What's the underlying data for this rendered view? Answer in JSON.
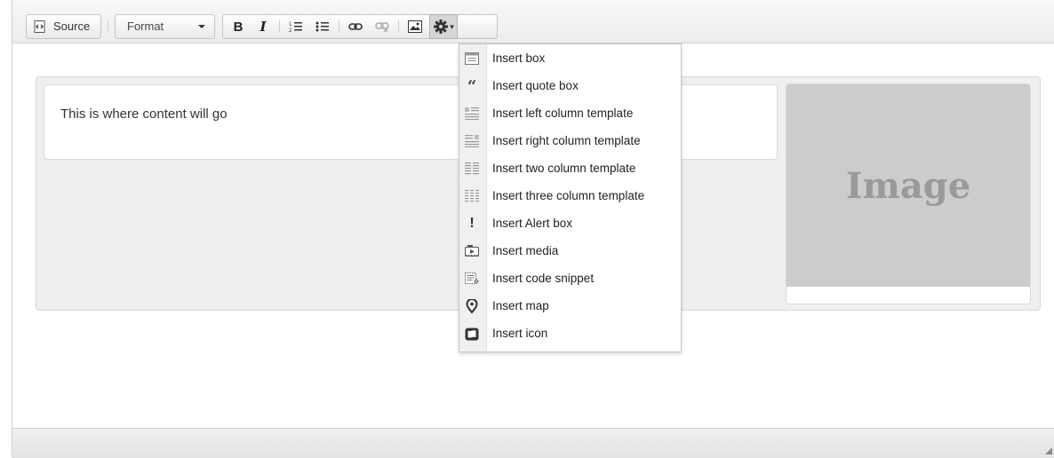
{
  "toolbar": {
    "source_label": "Source",
    "format_label": "Format",
    "buttons": [
      "bold",
      "italic",
      "numbered-list",
      "bulleted-list",
      "link",
      "unlink",
      "image",
      "plugins"
    ]
  },
  "content": {
    "text": "This is where content will go",
    "image_placeholder": "Image"
  },
  "menu": {
    "items": [
      {
        "label": "Insert box",
        "icon": "box-icon"
      },
      {
        "label": "Insert quote box",
        "icon": "quote-icon"
      },
      {
        "label": "Insert left column template",
        "icon": "left-column-icon"
      },
      {
        "label": "Insert right column template",
        "icon": "right-column-icon"
      },
      {
        "label": "Insert two column template",
        "icon": "two-column-icon"
      },
      {
        "label": "Insert three column template",
        "icon": "three-column-icon"
      },
      {
        "label": "Insert Alert box",
        "icon": "alert-icon"
      },
      {
        "label": "Insert media",
        "icon": "media-icon"
      },
      {
        "label": "Insert code snippet",
        "icon": "code-snippet-icon"
      },
      {
        "label": "Insert map",
        "icon": "map-pin-icon"
      },
      {
        "label": "Insert icon",
        "icon": "insert-icon-icon"
      }
    ]
  }
}
